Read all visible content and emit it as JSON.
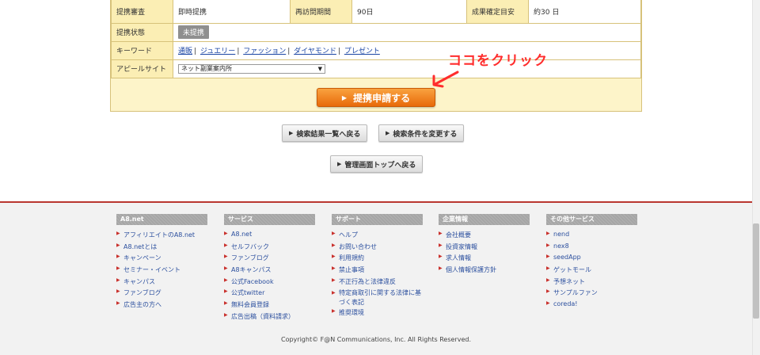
{
  "offer_table": {
    "row1": {
      "label1": "提携審査",
      "value1": "即時提携",
      "label2": "再訪問期間",
      "value2": "90日",
      "label3": "成果確定目安",
      "value3": "約30 日"
    },
    "status": {
      "label": "提携状態",
      "badge": "未提携"
    },
    "keywords": {
      "label": "キーワード",
      "items": [
        "通販",
        "ジュエリー",
        "ファッション",
        "ダイヤモンド",
        "プレゼント"
      ],
      "separator": "|"
    },
    "appeal_site": {
      "label": "アピールサイト",
      "selected": "ネット副業案内所"
    }
  },
  "apply_button": {
    "label": "提携申請する"
  },
  "annotation": {
    "text": "ココをクリック",
    "color": "#ff2d2d"
  },
  "nav_buttons": {
    "back_to_results": "検索結果一覧へ戻る",
    "change_conditions": "検索条件を変更する",
    "admin_top": "管理画面トップへ戻る"
  },
  "footer": {
    "columns": [
      {
        "title": "A8.net",
        "items": [
          "アフィリエイトのA8.net",
          "A8.netとは",
          "キャンペーン",
          "セミナー・イベント",
          "キャンパス",
          "ファンブログ",
          "広告主の方へ"
        ]
      },
      {
        "title": "サービス",
        "items": [
          "A8.net",
          "セルフバック",
          "ファンブログ",
          "A8キャンパス",
          "公式Facebook",
          "公式twitter",
          "無料会員登録",
          "広告出稿（資料請求）"
        ]
      },
      {
        "title": "サポート",
        "items": [
          "ヘルプ",
          "お問い合わせ",
          "利用規約",
          "禁止事項",
          "不正行為と法律違反",
          "特定商取引に関する法律に基づく表記",
          "推奨環境"
        ]
      },
      {
        "title": "企業情報",
        "items": [
          "会社概要",
          "投資家情報",
          "求人情報",
          "個人情報保護方針"
        ]
      },
      {
        "title": "その他サービス",
        "items": [
          "nend",
          "nex8",
          "seedApp",
          "ゲットモール",
          "予想ネット",
          "サンプルファン",
          "coreda!"
        ]
      }
    ],
    "copyright": "Copyright© F@N Communications, Inc. All Rights Reserved."
  },
  "colors": {
    "accent": "#e86a0a",
    "footer_border": "#b9362f",
    "link": "#2b4f9e",
    "annotation": "#ff2d2d"
  }
}
